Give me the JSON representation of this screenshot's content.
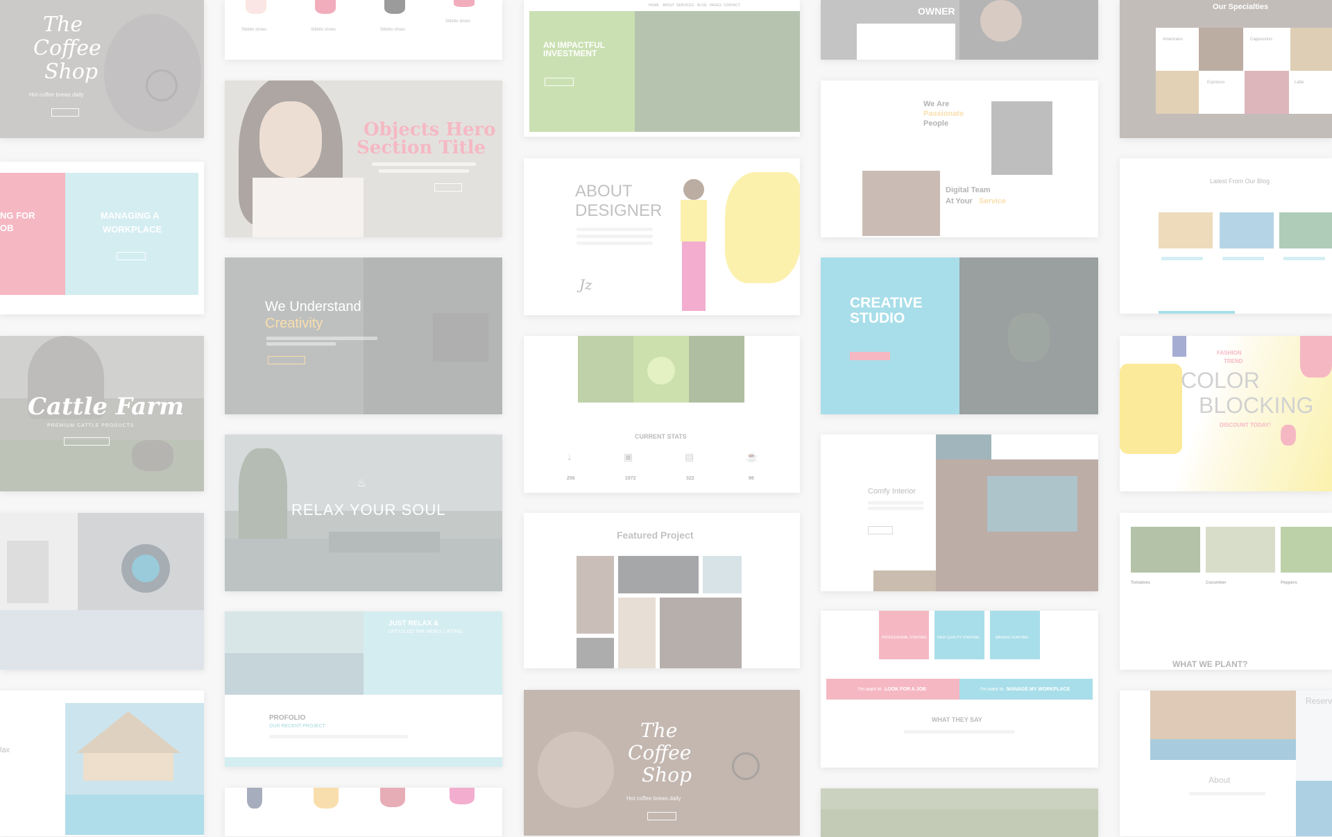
{
  "coffee_top": {
    "line1": "The",
    "line2": "Coffee",
    "line3": "Shop",
    "tagline": "Hot coffee brews daily"
  },
  "shoes_top": {
    "items": [
      "Stiletto shoes",
      "Stiletto shoes",
      "Stiletto shoes",
      "Stiletto shoes"
    ]
  },
  "investment": {
    "title_line1": "AN IMPACTFUL",
    "title_line2": "INVESTMENT",
    "nav": [
      "HOME",
      "ABOUT",
      "SERVICES",
      "BLOG",
      "PAGES",
      "CONTACT"
    ]
  },
  "owner": {
    "heading": "OWNER"
  },
  "specialities": {
    "title": "Our Specialties",
    "items": [
      "Americano",
      "Cappuccino",
      "Espresso",
      "Latte"
    ]
  },
  "job": {
    "left_line1": "NG FOR",
    "left_line2": "OB",
    "right_line1": "MANAGING A",
    "right_line2": "WORKPLACE"
  },
  "hero": {
    "line1": "Objects Hero",
    "line2": "Section Title"
  },
  "designer": {
    "line1": "ABOUT",
    "line2": "DESIGNER"
  },
  "team": {
    "we_are": "We Are",
    "passionate": "Passionate",
    "people": "People",
    "digital": "Digital Team",
    "at_your": "At Your",
    "service": "Service"
  },
  "blog": {
    "title": "Latest From Our Blog"
  },
  "creativity": {
    "line1": "We Understand",
    "line2": "Creativity"
  },
  "stats": {
    "title": "CURRENT STATS",
    "values": [
      "256",
      "1972",
      "322",
      "98"
    ]
  },
  "studio": {
    "line1": "CREATIVE",
    "line2": "STUDIO"
  },
  "color_blocking": {
    "line1": "COLOR",
    "line2": "BLOCKING",
    "kicker": "FASHION",
    "trend": "TREND",
    "discount": "DISCOUNT TODAY!"
  },
  "cattle": {
    "title": "Cattle Farm",
    "subtitle": "PREMIUM CATTLE PRODUCTS"
  },
  "relax": {
    "title": "RELAX YOUR SOUL"
  },
  "interior": {
    "title": "Comfy Interior"
  },
  "plants": {
    "title": "WHAT WE PLANT?",
    "items": [
      "Tomatoes",
      "Cucumber",
      "Peppers"
    ]
  },
  "featured": {
    "title": "Featured Project"
  },
  "relax2": {
    "line1": "JUST RELAX &",
    "line2": "LET US DO THE HEAVY LIFTING",
    "profolio": "PROFOLIO",
    "recent": "OUR RECENT PROJECT"
  },
  "services_card": {
    "tiles": [
      "PROFESSIONAL STAFFING",
      "HIGH QUALITY STAFFING",
      "MANAGE STAFFING",
      "LOOK FOR A JOB"
    ],
    "left_prefix": "I'm want to",
    "left_link": "LOOK FOR A JOB",
    "right_prefix": "I'm want to",
    "right_link": "MANAGE MY WORKPLACE",
    "testimonial": "WHAT THEY SAY"
  },
  "resort": {
    "about": "About",
    "reserve": "Reserv"
  },
  "relax_left": {
    "word": "lax"
  },
  "coffee_bottom": {
    "line1": "The",
    "line2": "Coffee",
    "line3": "Shop",
    "tagline": "Hot coffee brews daily"
  },
  "colors": {
    "accent_pink": "#f3a6b2",
    "accent_teal": "#9fd8df",
    "accent_yellow": "#f5e14a",
    "accent_red": "#e9637a",
    "accent_orange": "#f2b64a"
  }
}
